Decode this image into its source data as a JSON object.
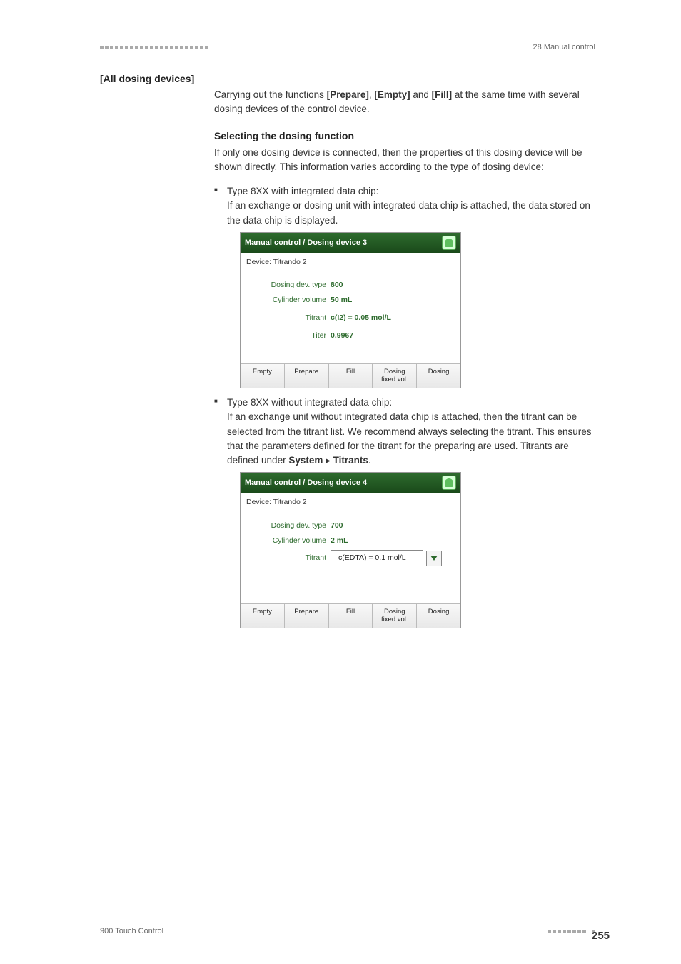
{
  "header": {
    "right_label": "28 Manual control"
  },
  "section_title": "[All dosing devices]",
  "intro": {
    "prefix": "Carrying out the functions ",
    "b1": "[Prepare]",
    "sep1": ", ",
    "b2": "[Empty]",
    "sep2": " and ",
    "b3": "[Fill]",
    "suffix": " at the same time with several dosing devices of the control device."
  },
  "sub_heading": "Selecting the dosing function",
  "intro2": "If only one dosing device is connected, then the properties of this dosing device will be shown directly. This information varies according to the type of dosing device:",
  "bullet1": {
    "line1": "Type 8XX with integrated data chip:",
    "line2": "If an exchange or dosing unit with integrated data chip is attached, the data stored on the data chip is displayed."
  },
  "screenshot1": {
    "title": "Manual control / Dosing device 3",
    "device": "Device: Titrando 2",
    "rows": {
      "dev_type_k": "Dosing dev. type",
      "dev_type_v": "800",
      "cyl_k": "Cylinder volume",
      "cyl_v": "50 mL",
      "titrant_k": "Titrant",
      "titrant_v": "c(I2) = 0.05 mol/L",
      "titer_k": "Titer",
      "titer_v": "0.9967"
    },
    "buttons": {
      "empty": "Empty",
      "prepare": "Prepare",
      "fill": "Fill",
      "dosing_fixed_l1": "Dosing",
      "dosing_fixed_l2": "fixed vol.",
      "dosing": "Dosing"
    }
  },
  "bullet2": {
    "line1": "Type 8XX without integrated data chip:",
    "line2_part1": "If an exchange unit without integrated data chip is attached, then the titrant can be selected from the titrant list. We recommend always selecting the titrant. This ensures that the parameters defined for the titrant for the preparing are used. Titrants are defined under ",
    "b1": "System",
    "arrow": " ▸ ",
    "b2": "Titrants",
    "end": "."
  },
  "screenshot2": {
    "title": "Manual control / Dosing device 4",
    "device": "Device: Titrando 2",
    "rows": {
      "dev_type_k": "Dosing dev. type",
      "dev_type_v": "700",
      "cyl_k": "Cylinder volume",
      "cyl_v": "2 mL",
      "titrant_k": "Titrant",
      "titrant_sel": "c(EDTA) = 0.1 mol/L"
    },
    "buttons": {
      "empty": "Empty",
      "prepare": "Prepare",
      "fill": "Fill",
      "dosing_fixed_l1": "Dosing",
      "dosing_fixed_l2": "fixed vol.",
      "dosing": "Dosing"
    }
  },
  "footer": {
    "left": "900 Touch Control",
    "page": "255"
  }
}
